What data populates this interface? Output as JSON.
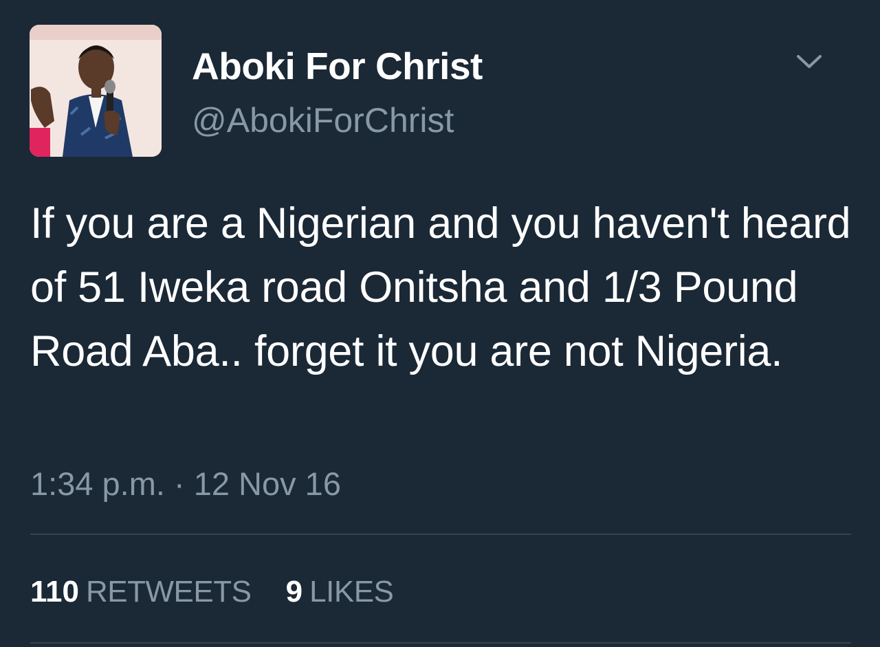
{
  "tweet": {
    "author": {
      "display_name": "Aboki For Christ",
      "handle": "@AbokiForChrist"
    },
    "text": "If you are a Nigerian and you haven't heard of 51 Iweka road Onitsha and 1/3 Pound Road Aba.. forget it you are not Nigeria.",
    "timestamp": "1:34 p.m. · 12 Nov 16",
    "stats": {
      "retweets_count": "110",
      "retweets_label": "RETWEETS",
      "likes_count": "9",
      "likes_label": "LIKES"
    }
  },
  "icons": {
    "menu": "chevron-down-icon"
  },
  "colors": {
    "background": "#1b2836",
    "primary_text": "#ffffff",
    "secondary_text": "#8899a6",
    "divider": "#38444d"
  }
}
